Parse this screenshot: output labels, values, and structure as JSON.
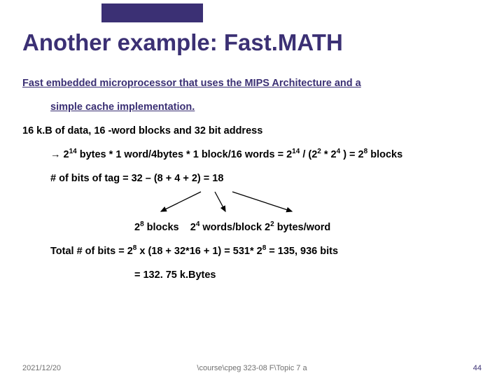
{
  "title": "Another example: Fast.MATH",
  "desc_a": "Fast embedded microprocessor that uses the MIPS Architecture and a",
  "desc_b": "simple cache implementation.",
  "spec": "16 k.B of data, 16 -word blocks and 32 bit address",
  "calc1_a": " 2",
  "calc1_b": " bytes * 1 word/4bytes * 1 block/16 words  = 2",
  "calc1_c": " / (2",
  "calc1_d": " * 2",
  "calc1_e": " ) = 2",
  "calc1_f": " blocks",
  "tag_a": "# of bits of tag = 32 – (8 + 4 + 2) = 18",
  "ann_a": "2",
  "ann_b": "  blocks",
  "ann_d": " words/block   2",
  "ann_f": " bytes/word",
  "tot_a": "Total # of bits = 2",
  "tot_b": " x (18 + 32*16 + 1) = 531* 2",
  "tot_c": " = 135, 936 bits",
  "kb": "= 132. 75 k.Bytes",
  "date": "2021/12/20",
  "path": "\\course\\cpeg 323-08 F\\Topic 7 a",
  "page": "44",
  "exp14": "14",
  "exp8": "8",
  "exp4": "4",
  "exp2": "2",
  "arrow": "→"
}
